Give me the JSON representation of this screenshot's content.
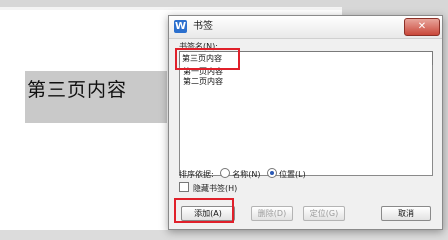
{
  "document": {
    "selected_text": "第三页内容"
  },
  "dialog": {
    "title": "书签",
    "app_icon_glyph": "W",
    "close_glyph": "✕",
    "name_label": "书签名(N):",
    "name_value": "第三页内容",
    "list_items": [
      "第一页内容",
      "第二页内容"
    ],
    "sort_label": "排序依据:",
    "sort_options": [
      {
        "label": "名称(N)",
        "selected": false
      },
      {
        "label": "位置(L)",
        "selected": true
      }
    ],
    "hide_label": "隐藏书签(H)",
    "hide_checked": false,
    "buttons": {
      "add": "添加(A)",
      "delete": "删除(D)",
      "locate": "定位(G)",
      "cancel": "取消"
    }
  },
  "highlight_color": "#e0202a"
}
